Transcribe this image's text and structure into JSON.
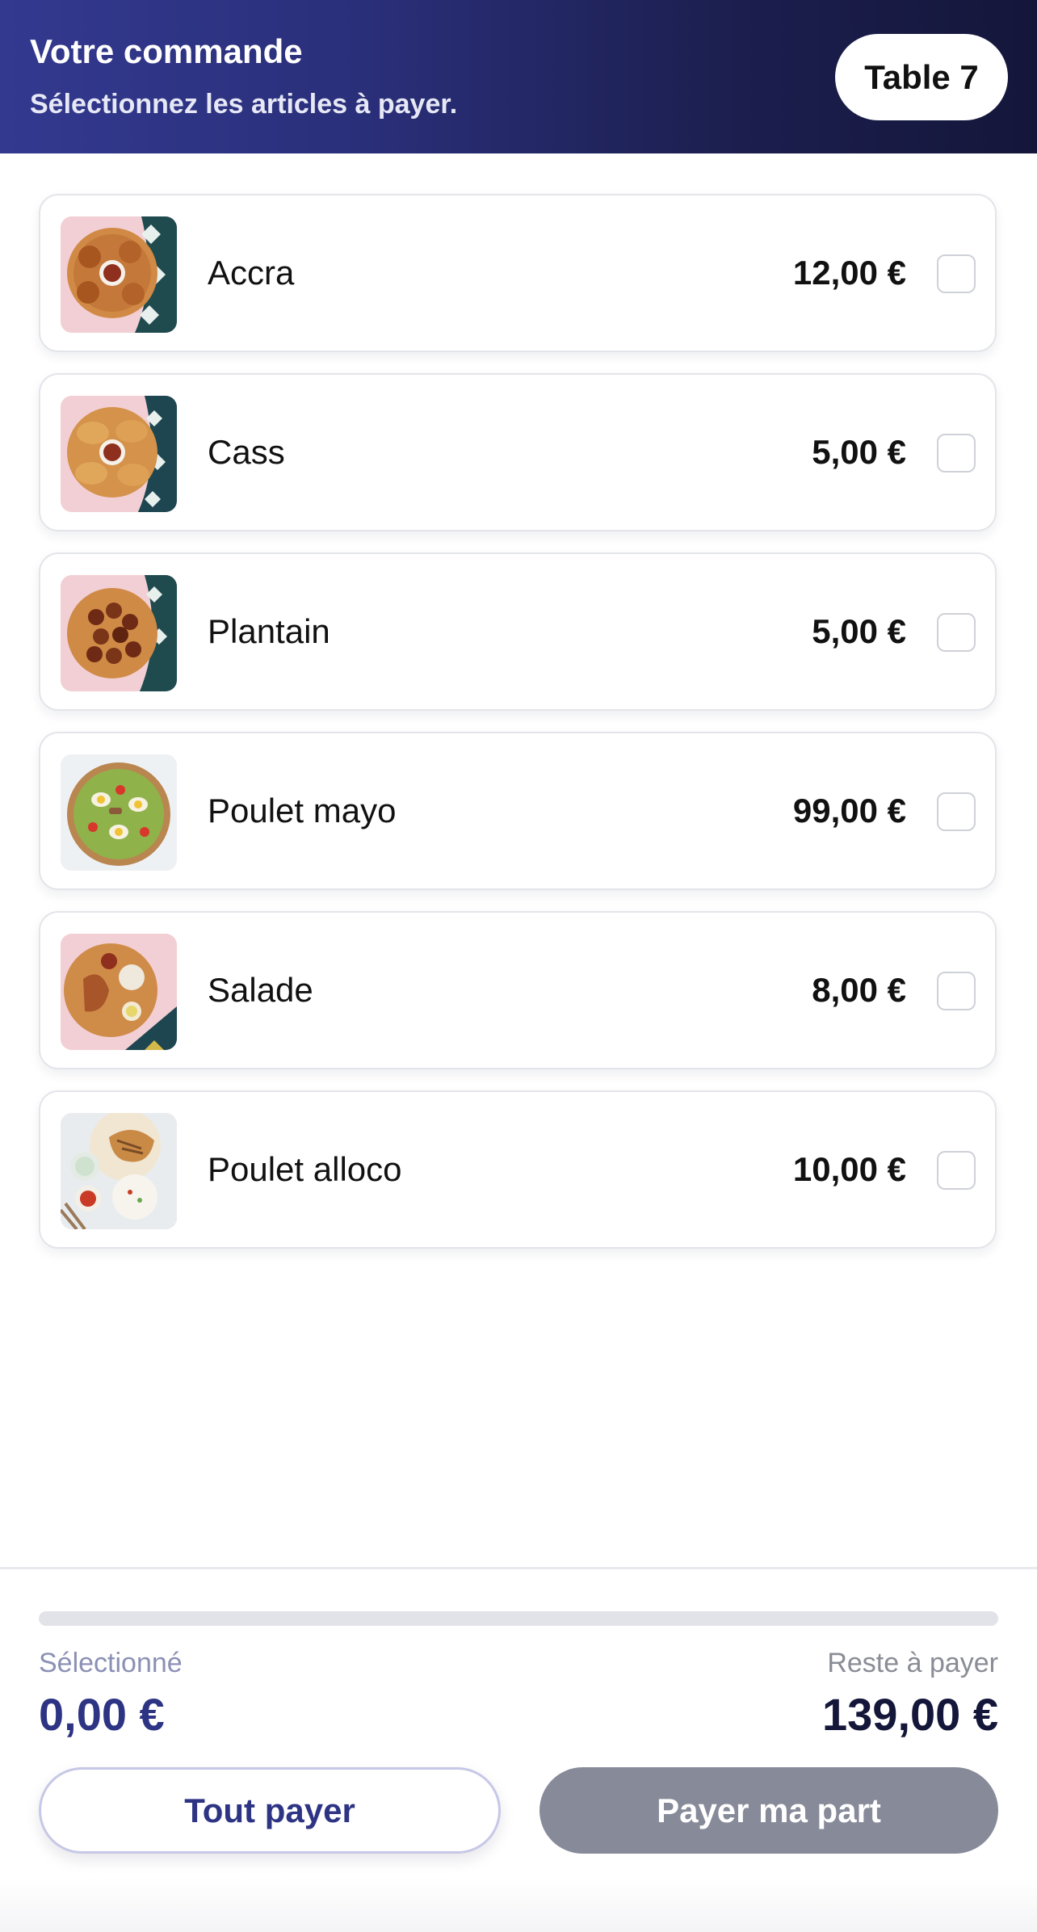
{
  "header": {
    "title": "Votre commande",
    "subtitle": "Sélectionnez les articles à payer.",
    "table_label": "Table 7"
  },
  "items": [
    {
      "name": "Accra",
      "price": "12,00 €",
      "image": "accra-photo",
      "checked": false
    },
    {
      "name": "Cass",
      "price": "5,00 €",
      "image": "cass-photo",
      "checked": false
    },
    {
      "name": "Plantain",
      "price": "5,00 €",
      "image": "plantain-photo",
      "checked": false
    },
    {
      "name": "Poulet mayo",
      "price": "99,00 €",
      "image": "poulet-mayo-photo",
      "checked": false
    },
    {
      "name": "Salade",
      "price": "8,00 €",
      "image": "salade-photo",
      "checked": false
    },
    {
      "name": "Poulet alloco",
      "price": "10,00 €",
      "image": "poulet-alloco-photo",
      "checked": false
    }
  ],
  "summary": {
    "progress": 0,
    "selected_label": "Sélectionné",
    "selected_value": "0,00 €",
    "remaining_label": "Reste à payer",
    "remaining_value": "139,00 €"
  },
  "buttons": {
    "pay_all": "Tout payer",
    "pay_share": "Payer ma part"
  },
  "colors": {
    "header_start": "#33398f",
    "header_end": "#14163a",
    "accent": "#2e3484",
    "disabled_button": "#878a99"
  }
}
